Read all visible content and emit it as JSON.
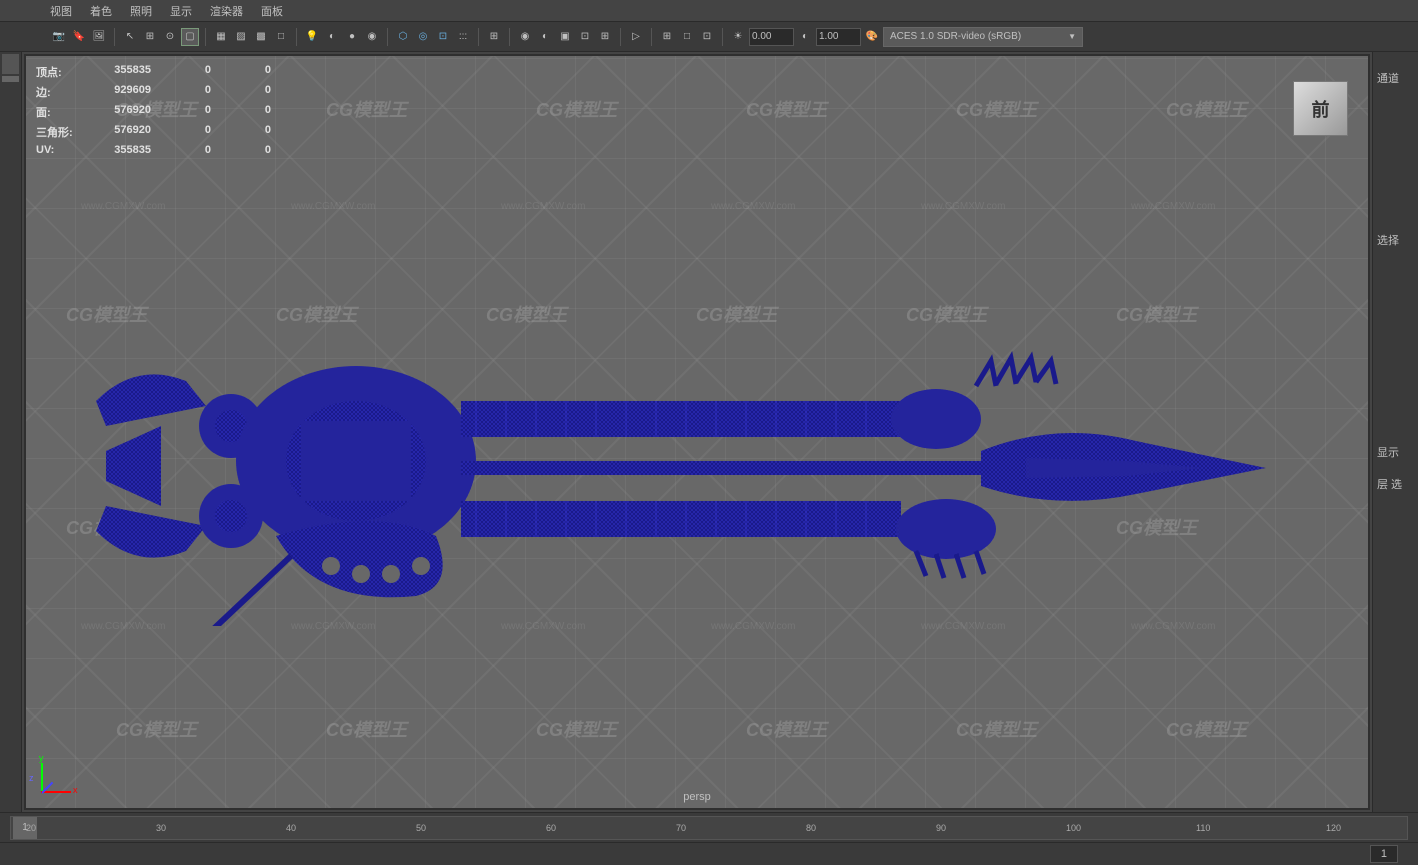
{
  "menu": {
    "items": [
      "视图",
      "着色",
      "照明",
      "显示",
      "渲染器",
      "面板"
    ]
  },
  "toolbar": {
    "exposure_value": "0.00",
    "gamma_value": "1.00",
    "colorspace": "ACES 1.0 SDR-video (sRGB)"
  },
  "stats": {
    "rows": [
      {
        "label": "顶点:",
        "vals": [
          "355835",
          "0",
          "0"
        ]
      },
      {
        "label": "边:",
        "vals": [
          "929609",
          "0",
          "0"
        ]
      },
      {
        "label": "面:",
        "vals": [
          "576920",
          "0",
          "0"
        ]
      },
      {
        "label": "三角形:",
        "vals": [
          "576920",
          "0",
          "0"
        ]
      },
      {
        "label": "UV:",
        "vals": [
          "355835",
          "0",
          "0"
        ]
      }
    ]
  },
  "viewport": {
    "camera": "persp",
    "cube_face": "前",
    "axis": {
      "x": "x",
      "y": "y",
      "z": "z"
    }
  },
  "watermarks": {
    "brand": "CG模型王",
    "url": "www.CGMXW.com"
  },
  "right_panel": {
    "items": [
      "通道",
      "选择",
      "显示",
      "层  选"
    ]
  },
  "timeline": {
    "start": 20,
    "end": 120,
    "current_frame": "1",
    "marker": "1"
  }
}
